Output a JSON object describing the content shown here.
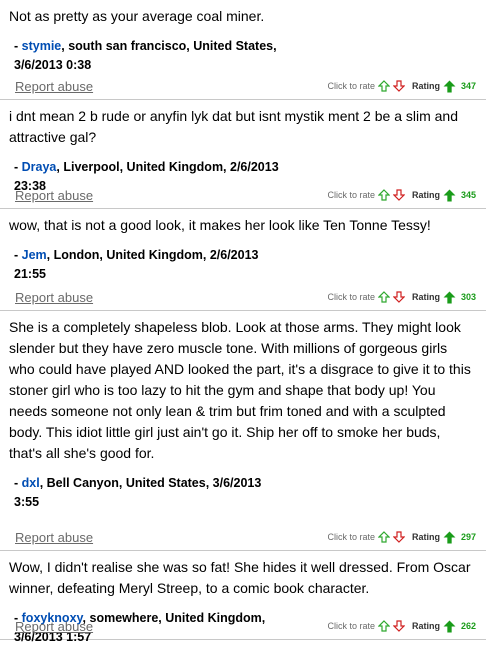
{
  "labels": {
    "report": "Report abuse",
    "click_to_rate": "Click to rate",
    "rating": "Rating",
    "dash": "- "
  },
  "comments": [
    {
      "text": "Not as pretty as your average coal miner.",
      "user": "stymie",
      "location": ", south san francisco, United States,",
      "date": "3/6/2013 0:38",
      "rating": "347"
    },
    {
      "text": "i dnt mean 2 b rude or anyfin lyk dat but isnt mystik ment 2 be a slim and attractive gal?",
      "user": "Draya",
      "location": ", Liverpool, United Kingdom, 2/6/2013",
      "date": "23:38",
      "rating": "345"
    },
    {
      "text": "wow, that is not a good look, it makes her look like Ten Tonne Tessy!",
      "user": "Jem",
      "location": ", London, United Kingdom, 2/6/2013",
      "date": "21:55",
      "rating": "303"
    },
    {
      "text": "She is a completely shapeless blob. Look at those arms. They might look slender but they have zero muscle tone. With millions of gorgeous girls who could have played AND looked the part, it's a disgrace to give it to this stoner girl who is too lazy to hit the gym and shape that body up! You needs someone not only lean & trim but frim toned and with a sculpted body. This idiot little girl just ain't go it. Ship her off to smoke her buds, that's all she's good for.",
      "user": "dxl",
      "location": ", Bell Canyon, United States, 3/6/2013",
      "date": "3:55",
      "rating": "297"
    },
    {
      "text": "Wow, I didn't realise she was so fat! She hides it well dressed. From Oscar winner, defeating Meryl Streep, to a comic book character.",
      "user": "foxyknoxy",
      "location": ", somewhere, United Kingdom,",
      "date": "3/6/2013 1:57",
      "rating": "262"
    }
  ],
  "colors": {
    "username": "#004db3",
    "thumb_up": "#2ea82e",
    "thumb_down": "#d02020",
    "rating_value": "#1a9c1a"
  },
  "icons": [
    "thumb-up-outline-icon",
    "thumb-down-outline-icon",
    "rating-up-arrow-icon"
  ]
}
